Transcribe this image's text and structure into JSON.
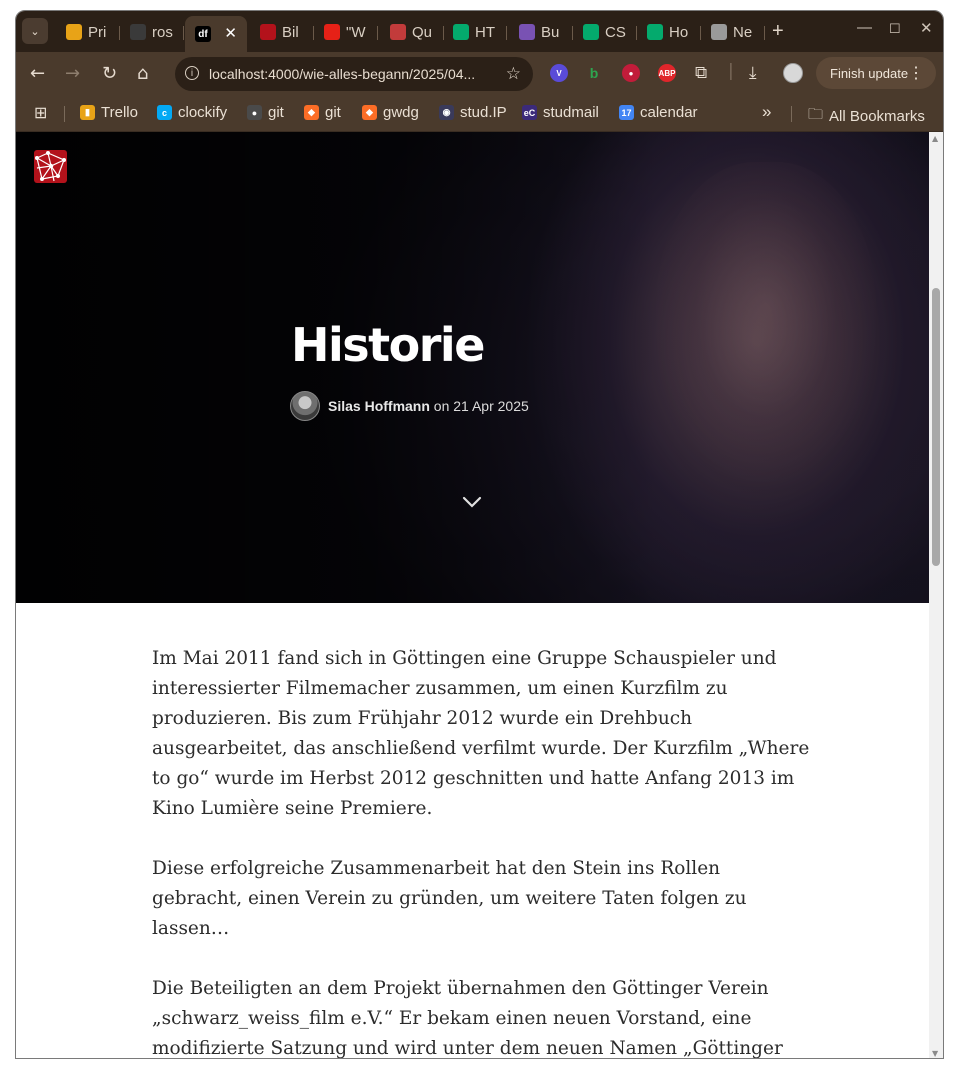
{
  "browser": {
    "tabs": [
      {
        "label": "Pri",
        "favicon": "presentation-icon",
        "color": "#e8a317",
        "active": false
      },
      {
        "label": "ros",
        "favicon": "github-icon",
        "color": "#3a3a3a",
        "active": false
      },
      {
        "label": "",
        "favicon": "df-icon",
        "color": "#000000",
        "active": true
      },
      {
        "label": "Bil",
        "favicon": "network-logo-icon",
        "color": "#b3121b",
        "active": false
      },
      {
        "label": "\"W",
        "favicon": "youtube-icon",
        "color": "#e62117",
        "active": false
      },
      {
        "label": "Qu",
        "favicon": "pen-icon",
        "color": "#c23b3b",
        "active": false
      },
      {
        "label": "HT",
        "favicon": "w3schools-icon",
        "color": "#04aa6d",
        "active": false
      },
      {
        "label": "Bu",
        "favicon": "bootstrap-icon",
        "color": "#7952b3",
        "active": false
      },
      {
        "label": "CS",
        "favicon": "w3schools-icon",
        "color": "#04aa6d",
        "active": false
      },
      {
        "label": "Ho",
        "favicon": "w3schools-icon",
        "color": "#04aa6d",
        "active": false
      },
      {
        "label": "Ne",
        "favicon": "chrome-icon",
        "color": "#9a9a9a",
        "active": false
      }
    ],
    "new_tab": "+",
    "address": {
      "url": "localhost:4000/wie-alles-begann/2025/04..."
    },
    "finish_update": "Finish update",
    "bookmarks": [
      {
        "label": "Trello",
        "icon": "trello-icon",
        "color": "#e8a317"
      },
      {
        "label": "clockify",
        "icon": "clockify-icon",
        "color": "#03a9f4"
      },
      {
        "label": "git",
        "icon": "github-icon",
        "color": "#4a4a4a"
      },
      {
        "label": "git",
        "icon": "gitlab-icon",
        "color": "#fc6d26"
      },
      {
        "label": "gwdg",
        "icon": "gitlab-icon",
        "color": "#fc6d26"
      },
      {
        "label": "stud.IP",
        "icon": "studip-icon",
        "color": "#3a3a5a"
      },
      {
        "label": "studmail",
        "icon": "mail-icon",
        "color": "#3b2a7a"
      },
      {
        "label": "calendar",
        "icon": "calendar-icon",
        "color": "#4285f4"
      }
    ],
    "bookmarks_overflow": "»",
    "all_bookmarks": "All Bookmarks"
  },
  "page": {
    "title": "Historie",
    "author": "Silas Hoffmann",
    "date_text": "on 21 Apr 2025",
    "paragraphs": [
      "Im Mai 2011 fand sich in Göttingen eine Gruppe Schauspieler und interessierter Filmemacher zusammen, um einen Kurzfilm zu produzieren. Bis zum Frühjahr 2012 wurde ein Drehbuch ausgearbeitet, das anschließend verfilmt wurde. Der Kurzfilm „Where to go“ wurde im Herbst 2012 geschnitten und hatte Anfang 2013 im Kino Lumière seine Premiere.",
      "Diese erfolgreiche Zusammenarbeit hat den Stein ins Rollen gebracht, einen Verein zu gründen, um weitere Taten folgen zu lassen…",
      "Die Beteiligten an dem Projekt übernahmen den Göttinger Verein „schwarz_weiss_film e.V.“ Er bekam einen neuen Vorstand, eine modifizierte Satzung und wird unter dem neuen Namen „Göttinger FilmnetzWerk e.V.“ fortgeführt."
    ]
  },
  "colors": {
    "chrome_dark": "#2b2017",
    "chrome_toolbar": "#4a3a2c",
    "logo_red": "#b3121b",
    "text_body": "#2c2c2c"
  }
}
